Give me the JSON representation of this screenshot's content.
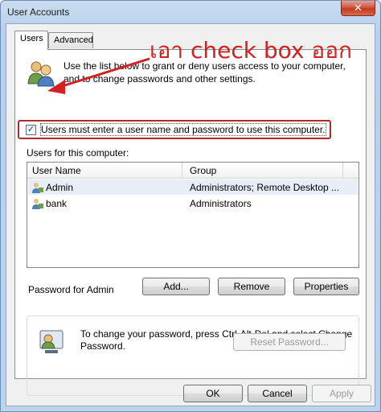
{
  "window": {
    "title": "User Accounts",
    "close_label": "✕"
  },
  "tabs": [
    {
      "label": "Users"
    },
    {
      "label": "Advanced"
    }
  ],
  "description": "Use the list below to grant or deny users access to your computer, and to change passwords and other settings.",
  "checkbox": {
    "label": "Users must enter a user name and password to use this computer.",
    "checked": true,
    "glyph": "✓"
  },
  "users_section": {
    "label": "Users for this computer:"
  },
  "table": {
    "columns": [
      "User Name",
      "Group"
    ],
    "rows": [
      {
        "name": "Admin",
        "group": "Administrators; Remote Desktop ..."
      },
      {
        "name": "bank",
        "group": "Administrators"
      }
    ]
  },
  "buttons": {
    "add": "Add...",
    "remove": "Remove",
    "properties": "Properties"
  },
  "password_group": {
    "title": "Password for Admin",
    "text": "To change your password, press Ctrl-Alt-Del and select Change Password.",
    "reset_label": "Reset Password..."
  },
  "footer": {
    "ok": "OK",
    "cancel": "Cancel",
    "apply": "Apply"
  },
  "annotation": {
    "text": "เอา check box ออก",
    "color": "#d42020"
  },
  "icons": {
    "users": "users-icon",
    "user": "user-icon",
    "password": "password-icon",
    "arrow": "arrow-icon"
  }
}
